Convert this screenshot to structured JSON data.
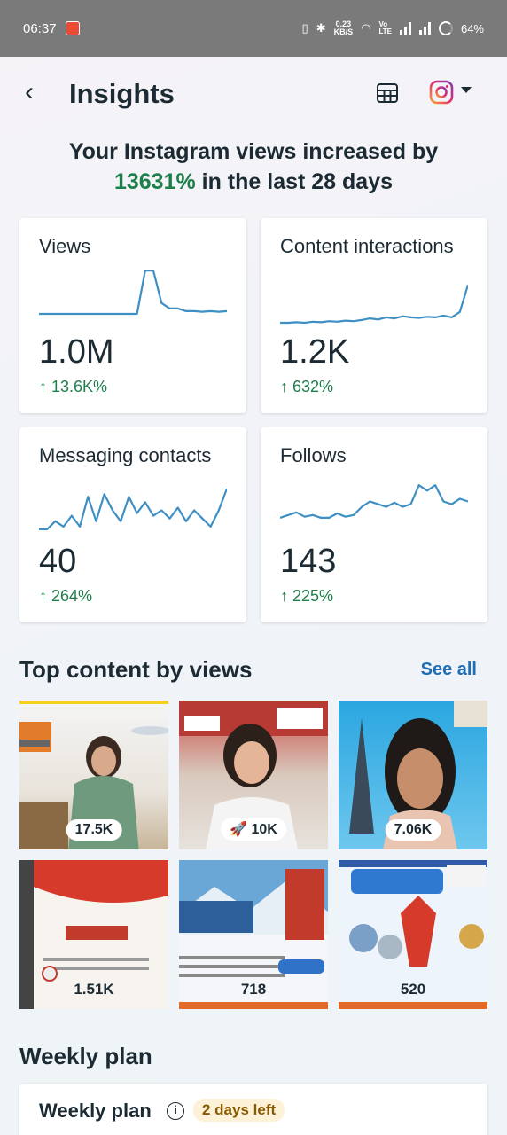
{
  "status": {
    "time": "06:37",
    "net_speed_top": "0.23",
    "net_speed_bottom": "KB/S",
    "lte_top": "Vo",
    "lte_bottom": "LTE",
    "battery": "64%"
  },
  "header": {
    "title": "Insights"
  },
  "headline": {
    "line1": "Your Instagram views increased by",
    "percent": "13631%",
    "rest": " in the last 28 days"
  },
  "cards": [
    {
      "title": "Views",
      "value": "1.0M",
      "change": "↑ 13.6K%",
      "trend": [
        0,
        0,
        0,
        0,
        0,
        0,
        0,
        0,
        0,
        0,
        0,
        0,
        0,
        0.8,
        0.8,
        0.2,
        0.1,
        0.1,
        0.05,
        0.05,
        0.04,
        0.05,
        0.04,
        0.05
      ]
    },
    {
      "title": "Content interactions",
      "value": "1.2K",
      "change": "↑ 632%",
      "trend": [
        0,
        0,
        0.01,
        0,
        0.02,
        0.01,
        0.03,
        0.02,
        0.04,
        0.03,
        0.05,
        0.08,
        0.06,
        0.1,
        0.08,
        0.12,
        0.1,
        0.09,
        0.11,
        0.1,
        0.13,
        0.1,
        0.2,
        0.7
      ]
    },
    {
      "title": "Messaging contacts",
      "value": "40",
      "change": "↑ 264%",
      "trend": [
        0.05,
        0.05,
        0.2,
        0.1,
        0.3,
        0.1,
        0.65,
        0.2,
        0.7,
        0.4,
        0.2,
        0.65,
        0.35,
        0.55,
        0.3,
        0.4,
        0.25,
        0.45,
        0.2,
        0.4,
        0.25,
        0.1,
        0.4,
        0.8
      ]
    },
    {
      "title": "Follows",
      "value": "143",
      "change": "↑ 225%",
      "trend": [
        0.1,
        0.15,
        0.2,
        0.12,
        0.15,
        0.1,
        0.1,
        0.18,
        0.12,
        0.15,
        0.3,
        0.4,
        0.35,
        0.3,
        0.38,
        0.3,
        0.35,
        0.7,
        0.6,
        0.7,
        0.4,
        0.35,
        0.45,
        0.4
      ]
    }
  ],
  "top_content": {
    "title": "Top content by views",
    "see_all": "See all",
    "items": [
      {
        "value": "17.5K",
        "style": "pill"
      },
      {
        "value": "10K",
        "style": "pill",
        "icon": "rocket-icon"
      },
      {
        "value": "7.06K",
        "style": "pill"
      },
      {
        "value": "1.51K",
        "style": "plain"
      },
      {
        "value": "718",
        "style": "plain"
      },
      {
        "value": "520",
        "style": "plain"
      }
    ]
  },
  "weekly": {
    "section_title": "Weekly plan",
    "card_title": "Weekly plan",
    "badge": "2 days left"
  },
  "colors": {
    "positive": "#1d7f4a",
    "link": "#1e6fb8",
    "chart_line": "#3e8fc4"
  }
}
